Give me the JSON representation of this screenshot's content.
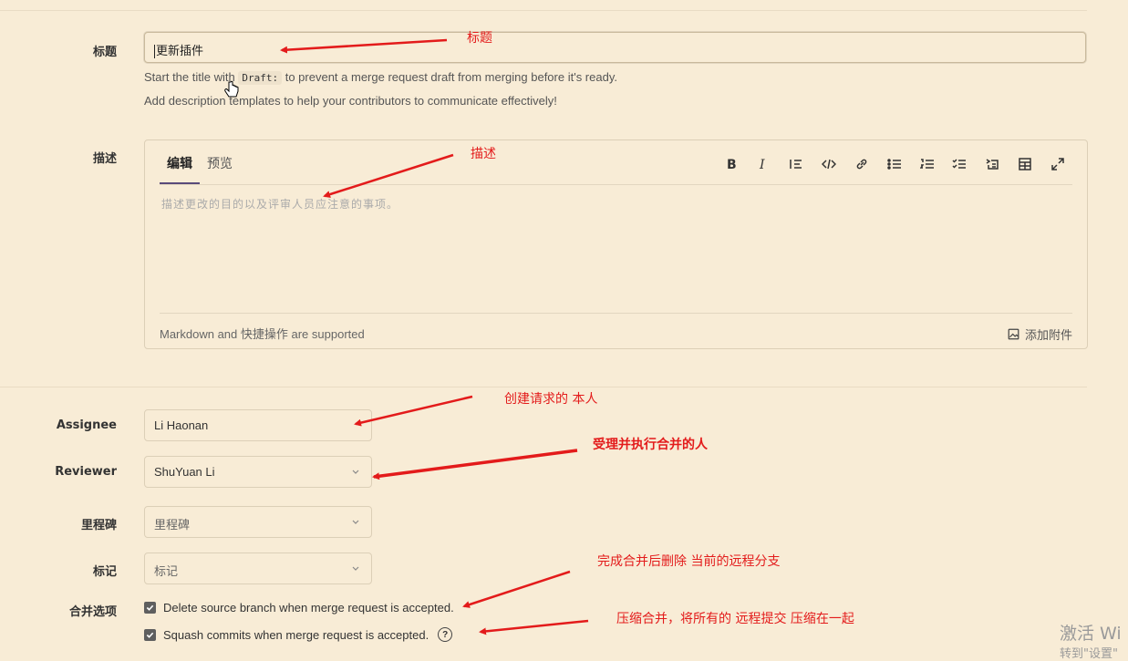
{
  "title_field": {
    "label": "标题",
    "value": "更新插件"
  },
  "help": {
    "draft_pre": "Start the title with",
    "draft_code": "Draft:",
    "draft_post": "to prevent a merge request draft from merging before it's ready.",
    "templates": "Add description templates to help your contributors to communicate effectively!"
  },
  "description": {
    "label": "描述",
    "tab_edit": "编辑",
    "tab_preview": "预览",
    "placeholder": "描述更改的目的以及评审人员应注意的事项。",
    "markdown_note": "Markdown and 快捷操作 are supported",
    "attach": "添加附件",
    "toolbar": [
      "bold-icon",
      "italic-icon",
      "quote-icon",
      "code-icon",
      "link-icon",
      "bullet-list-icon",
      "numbered-list-icon",
      "task-list-icon",
      "collapsible-icon",
      "table-icon",
      "fullscreen-icon"
    ]
  },
  "assignee": {
    "label": "Assignee",
    "value": "Li Haonan"
  },
  "reviewer": {
    "label": "Reviewer",
    "value": "ShuYuan Li"
  },
  "milestone": {
    "label": "里程碑",
    "value": "里程碑"
  },
  "labels": {
    "label": "标记",
    "value": "标记"
  },
  "merge_options": {
    "label": "合并选项",
    "delete_branch": "Delete source branch when merge request is accepted.",
    "squash": "Squash commits when merge request is accepted.",
    "delete_checked": true,
    "squash_checked": true
  },
  "annotations": {
    "title": "标题",
    "desc": "描述",
    "assignee": "创建请求的 本人",
    "reviewer": "受理并执行合并的人",
    "delete": "完成合并后删除 当前的远程分支",
    "squash": "压缩合并，将所有的 远程提交 压缩在一起"
  },
  "watermark": {
    "line1": "激活 Wi",
    "line2": "转到\"设置\""
  },
  "colors": {
    "annotation": "#e31b1b",
    "background": "#f8ecd6"
  }
}
